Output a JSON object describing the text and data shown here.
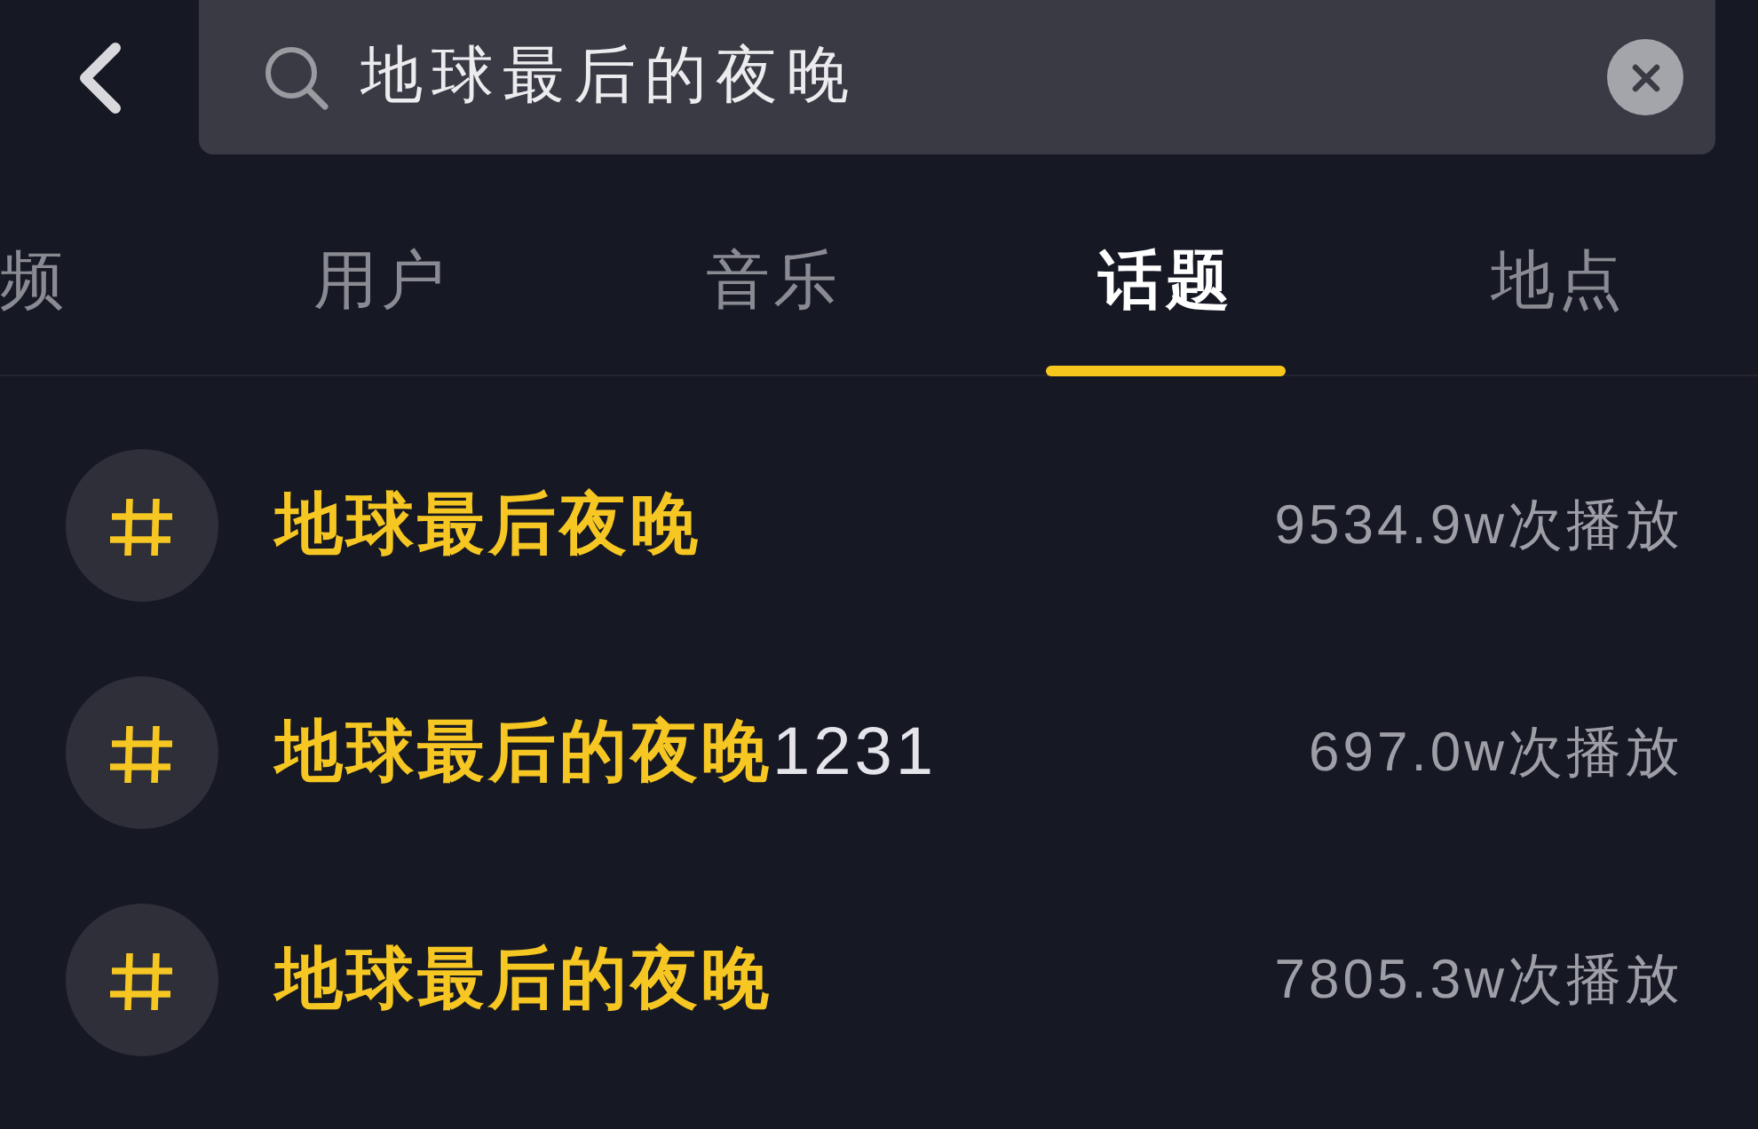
{
  "search": {
    "value": "地球最后的夜晚"
  },
  "tabs": [
    {
      "label": "频",
      "selected": false
    },
    {
      "label": "用户",
      "selected": false
    },
    {
      "label": "音乐",
      "selected": false
    },
    {
      "label": "话题",
      "selected": true
    },
    {
      "label": "地点",
      "selected": false
    }
  ],
  "topics": [
    {
      "title": [
        {
          "text": "地球最后夜晚",
          "highlight": true
        }
      ],
      "plays": "9534.9w次播放"
    },
    {
      "title": [
        {
          "text": "地球最后的夜晚",
          "highlight": true
        },
        {
          "text": "1231",
          "highlight": false
        }
      ],
      "plays": "697.0w次播放"
    },
    {
      "title": [
        {
          "text": "地球最后的夜晚",
          "highlight": true
        }
      ],
      "plays": "7805.3w次播放"
    }
  ]
}
